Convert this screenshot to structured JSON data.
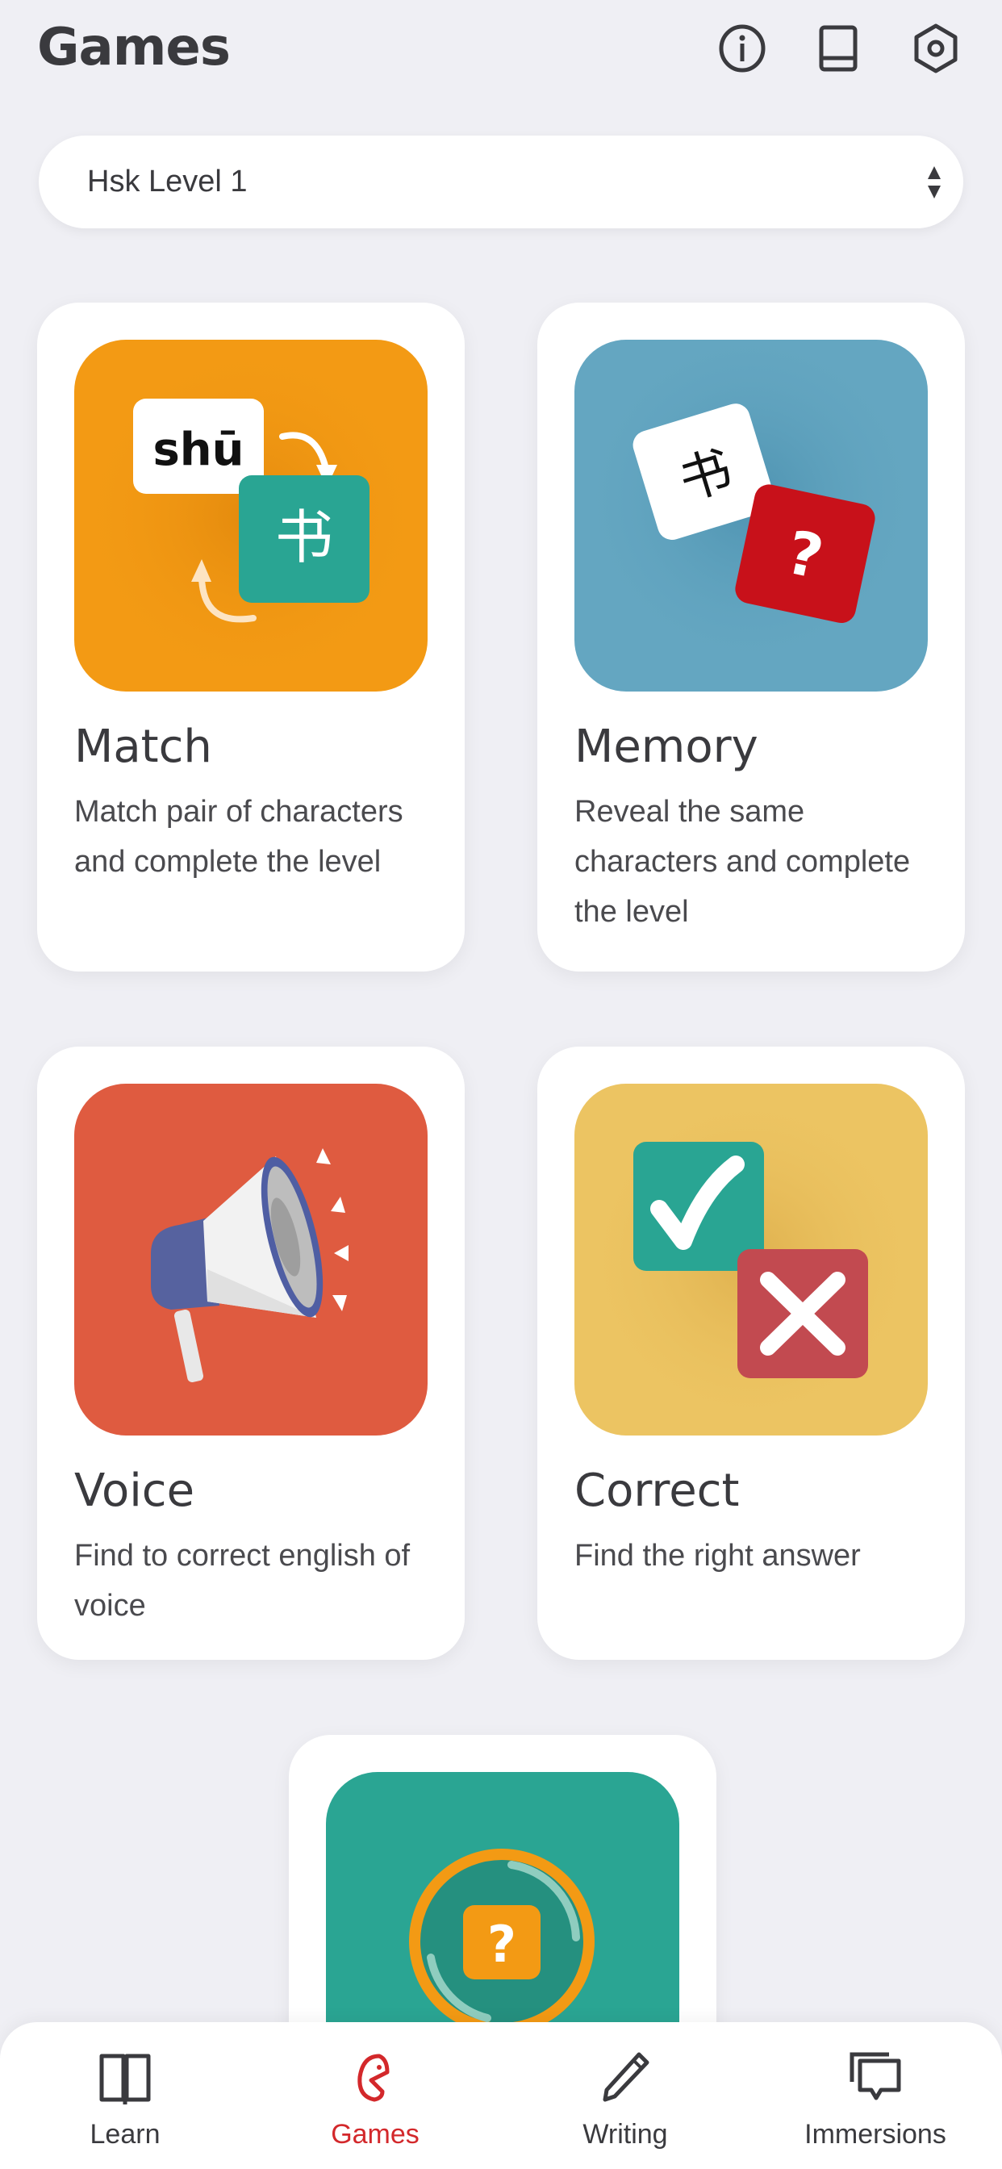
{
  "header": {
    "title": "Games",
    "icons": [
      "info-icon",
      "book-icon",
      "settings-icon"
    ]
  },
  "level_select": {
    "value": "Hsk Level 1"
  },
  "games": [
    {
      "title": "Match",
      "description": "Match pair of characters and complete the level",
      "color": "#f39a14",
      "pinyin": "shū",
      "hanzi": "书"
    },
    {
      "title": "Memory",
      "description": "Reveal the same characters and complete the level",
      "color": "#64a6c1",
      "hanzi": "书",
      "mystery": "?"
    },
    {
      "title": "Voice",
      "description": "Find to correct english of voice",
      "color": "#df5b40"
    },
    {
      "title": "Correct",
      "description": "Find the right answer",
      "color": "#ecc462"
    },
    {
      "title": "",
      "description": "",
      "color": "#2aa593",
      "mystery": "?"
    }
  ],
  "nav": {
    "active": "Games",
    "accent": "#d3282b",
    "items": [
      {
        "label": "Learn",
        "icon": "book-open-icon"
      },
      {
        "label": "Games",
        "icon": "games-icon"
      },
      {
        "label": "Writing",
        "icon": "pencil-icon"
      },
      {
        "label": "Immersions",
        "icon": "chat-icon"
      }
    ]
  }
}
